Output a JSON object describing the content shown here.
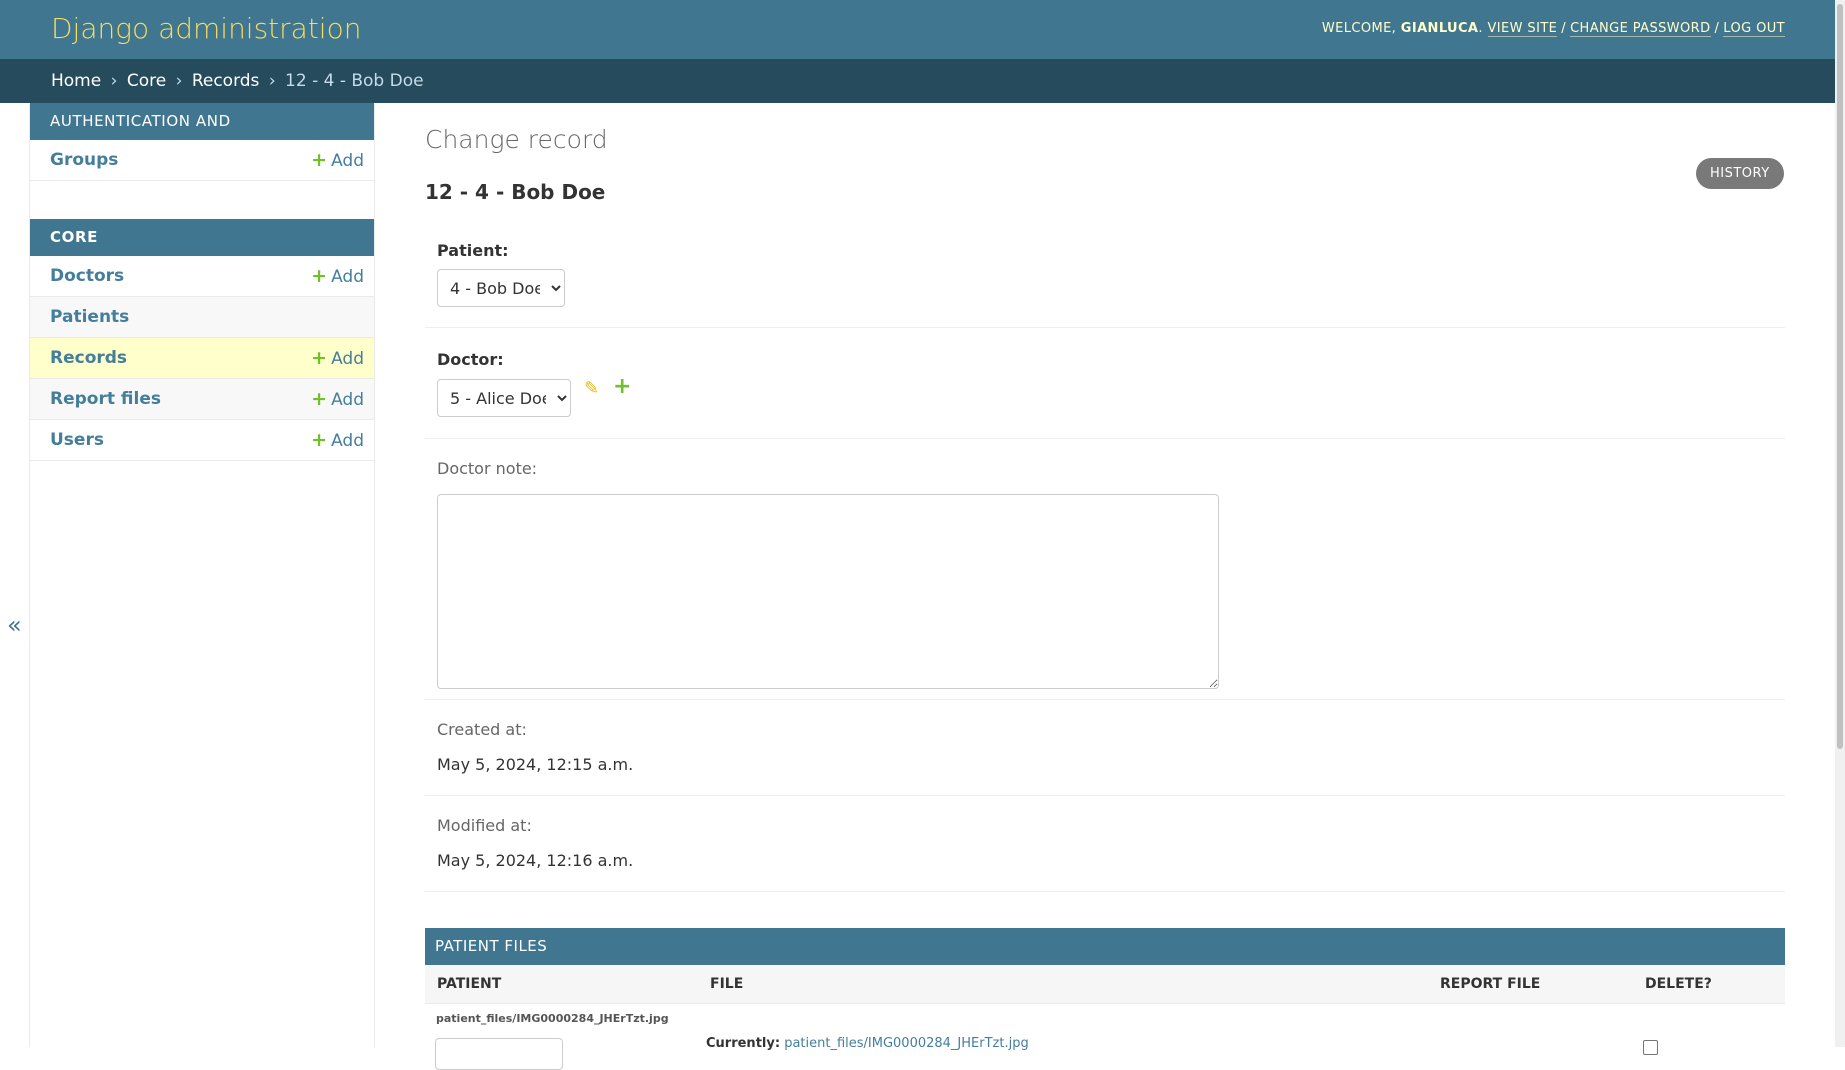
{
  "header": {
    "branding": "Django administration",
    "welcome": "Welcome,",
    "username": "Gianluca",
    "view_site": "View site",
    "change_password": "Change password",
    "log_out": "Log out"
  },
  "breadcrumbs": {
    "home": "Home",
    "app": "Core",
    "model": "Records",
    "current": "12 - 4 - Bob Doe",
    "separator": "›"
  },
  "sidebar": {
    "toggle": "«",
    "auth_caption": "Authentication and Authorization",
    "auth_items": [
      {
        "label": "Groups",
        "add": "Add"
      }
    ],
    "core_caption": "Core",
    "core_items": [
      {
        "label": "Doctors",
        "add": "Add"
      },
      {
        "label": "Patients",
        "add": ""
      },
      {
        "label": "Records",
        "add": "Add"
      },
      {
        "label": "Report files",
        "add": "Add"
      },
      {
        "label": "Users",
        "add": "Add"
      }
    ]
  },
  "main": {
    "title": "Change record",
    "object_title": "12 - 4 - Bob Doe",
    "history_button": "History",
    "patient_label": "Patient:",
    "patient_value": "4 - Bob Doe",
    "doctor_label": "Doctor:",
    "doctor_value": "5 - Alice Doe",
    "doctor_note_label": "Doctor note:",
    "doctor_note_value": "",
    "created_label": "Created at:",
    "created_value": "May 5, 2024, 12:15 a.m.",
    "modified_label": "Modified at:",
    "modified_value": "May 5, 2024, 12:16 a.m."
  },
  "inline": {
    "caption": "Patient files",
    "columns": [
      "Patient",
      "File",
      "Report file",
      "Delete?"
    ],
    "row_original": "patient_files/IMG0000284_JHErTzt.jpg",
    "currently_label": "Currently:",
    "currently_link": "patient_files/IMG0000284_JHErTzt.jpg"
  },
  "icons": {
    "add": "+",
    "edit": "✎"
  },
  "colors": {
    "header_bg": "#417690",
    "breadcrumbs_bg": "#264b5d",
    "branding": "#f5dd5d",
    "link": "#447e9b",
    "add_plus": "#70bf2b",
    "edit_pencil": "#efb80b",
    "current_row": "#ffffcc"
  }
}
